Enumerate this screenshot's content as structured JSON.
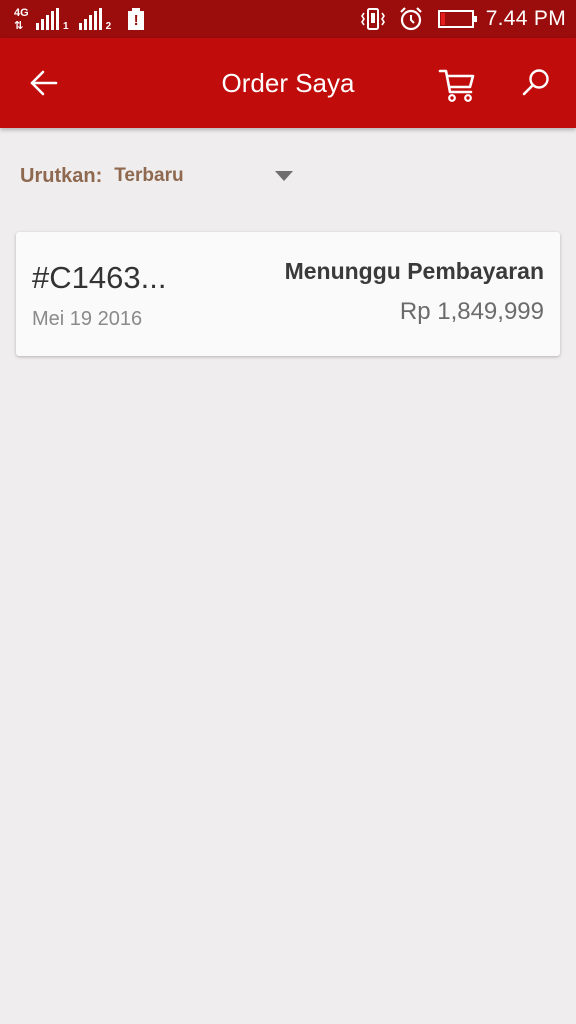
{
  "status_bar": {
    "network_label": "4G",
    "network_arrows": "⇅",
    "sim1": "1",
    "sim2": "2",
    "alert_symbol": "!",
    "battery_level": "14",
    "time": "7.44 PM"
  },
  "app_bar": {
    "title": "Order Saya",
    "icons": {
      "back": "arrow-left-icon",
      "cart": "cart-icon",
      "search": "search-icon"
    }
  },
  "sort": {
    "label": "Urutkan:",
    "selected": "Terbaru"
  },
  "orders": [
    {
      "id": "#C1463...",
      "date": "Mei 19 2016",
      "status": "Menunggu Pembayaran",
      "amount": "Rp 1,849,999"
    }
  ],
  "colors": {
    "status_bar": "#9b0d0d",
    "app_bar": "#c10c0c",
    "background": "#efeded",
    "sort_text": "#8e6950",
    "battery_fill": "#e51c1c"
  }
}
